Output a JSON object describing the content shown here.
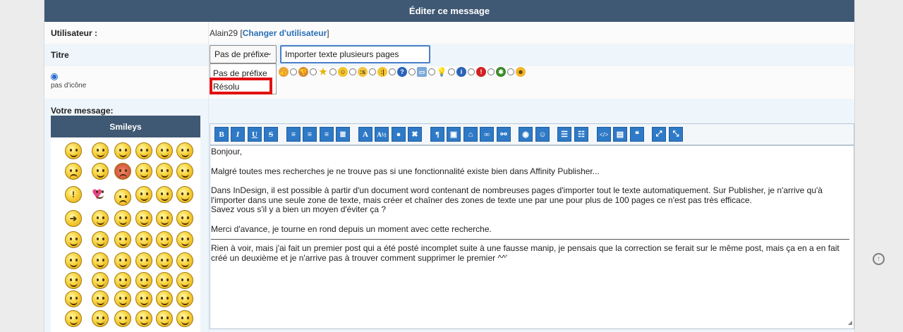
{
  "header": {
    "title": "Éditer ce message"
  },
  "user_row": {
    "label": "Utilisateur :",
    "username": "Alain29",
    "bracket_open": "[",
    "change_link": "Changer d'utilisateur",
    "bracket_close": "]"
  },
  "title_row": {
    "label": "Titre",
    "prefix_select": {
      "value": "Pas de préfixe",
      "options": [
        "Pas de préfixe",
        "Résolu"
      ],
      "highlighted_option": "Résolu"
    },
    "title_value": "Importer texte plusieurs pages"
  },
  "icon_row": {
    "no_icon_label": "pas d'icône",
    "selected": "pas d'icône"
  },
  "message": {
    "label": "Votre message:",
    "smileys_title": "Smileys",
    "toolbar": [
      "B",
      "I",
      "U",
      "S",
      "align-left",
      "align-center",
      "align-right",
      "justify",
      "A",
      "font-size",
      "color",
      "clear",
      "¶",
      "image",
      "host",
      "link",
      "unlink",
      "photo",
      "smiley",
      "ul",
      "ol",
      "code",
      "page",
      "quote",
      "expand",
      "shrink"
    ],
    "text": {
      "line1": "Bonjour,",
      "line2": "Malgré toutes mes recherches je ne trouve pas si une fonctionnalité existe bien dans Affinity Publisher...",
      "line3": "Dans InDesign, il est possible à partir d'un document word contenant de nombreuses pages d'importer tout le texte automatiquement. Sur Publisher, je n'arrive qu'à l'importer dans une seule zone de texte, mais créer et chaîner des zones de texte une par une pour plus de 100 pages ce n'est pas très efficace.",
      "line4": "Savez vous s'il y a bien un moyen d'éviter ça ?",
      "line5": "Merci d'avance, je tourne en rond depuis un moment avec cette recherche.",
      "line6": "Rien à voir, mais j'ai fait un premier post qui a été posté incomplet suite à une fausse manip, je pensais que la correction se ferait sur le même post, mais ça en a en fait créé un deuxième et je n'arrive pas à trouver comment supprimer le premier ^^'"
    }
  },
  "colors": {
    "header_bg": "#3f5873",
    "button_bg": "#2f7ac7",
    "highlight_border": "#e21010",
    "link": "#2a6fb5"
  }
}
